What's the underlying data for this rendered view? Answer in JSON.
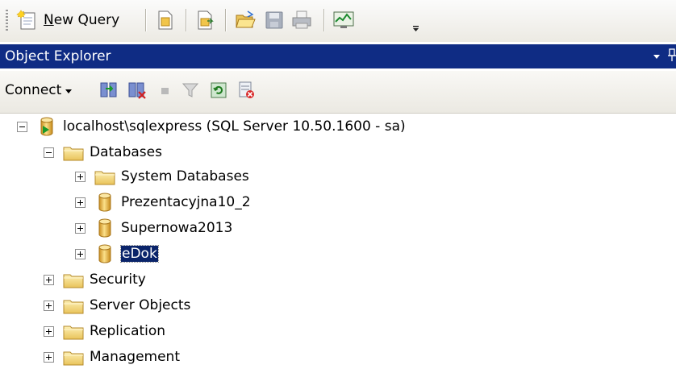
{
  "toolbar": {
    "new_query_label": "New Query",
    "new_query_mnemonic": "N",
    "buttons": [
      "new-file-icon",
      "new-file-copy-icon",
      "open-folder-icon",
      "save-icon",
      "print-icon",
      "activity-monitor-icon",
      "toolbar-overflow-icon"
    ]
  },
  "panel": {
    "title": "Object Explorer"
  },
  "oe_toolbar": {
    "connect_label": "Connect",
    "buttons": [
      "connect-object-explorer-icon",
      "disconnect-icon",
      "stop-icon",
      "filter-icon",
      "refresh-icon",
      "object-explorer-details-icon"
    ]
  },
  "tree": {
    "server": "localhost\\sqlexpress (SQL Server 10.50.1600 - sa)",
    "databases": "Databases",
    "system_databases": "System Databases",
    "db1": "Prezentacyjna10_2",
    "db2": "Supernowa2013",
    "db3": "eDok",
    "security": "Security",
    "server_objects": "Server Objects",
    "replication": "Replication",
    "management": "Management"
  },
  "colors": {
    "titlebar": "#0f2c84",
    "selection": "#0a246a",
    "folder": "#f5d36b",
    "database": "#e8b64a"
  }
}
